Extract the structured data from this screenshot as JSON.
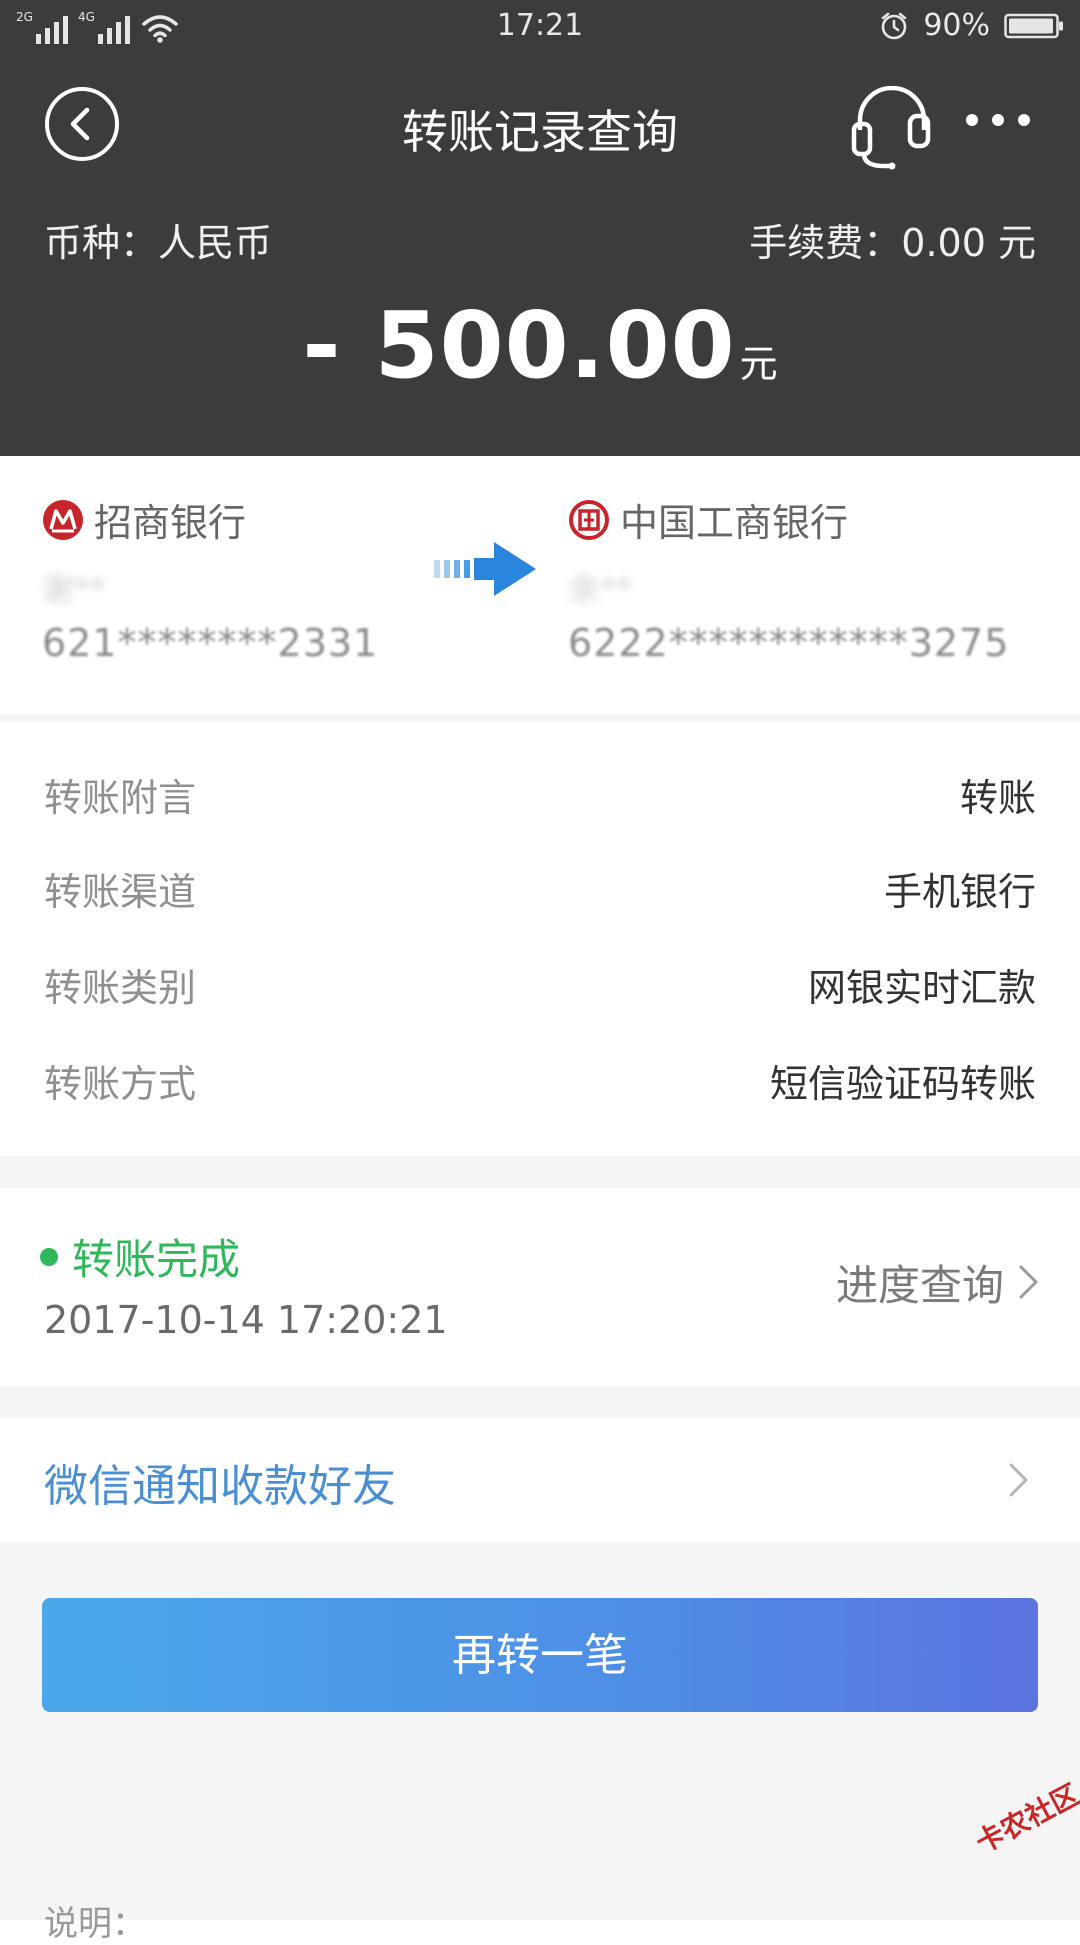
{
  "status_bar": {
    "network_1": "2G",
    "network_2": "4G",
    "time": "17:21",
    "battery": "90%"
  },
  "header": {
    "title": "转账记录查询",
    "currency_label": "币种：人民币",
    "fee_label": "手续费：0.00 元",
    "amount": "- 500.00",
    "amount_unit": "元"
  },
  "accounts": {
    "from": {
      "bank": "招商银行",
      "name": "谢**",
      "number": "621********2331"
    },
    "to": {
      "bank": "中国工商银行",
      "name": "余**",
      "number": "6222************3275"
    }
  },
  "details": [
    {
      "label": "转账附言",
      "value": "转账"
    },
    {
      "label": "转账渠道",
      "value": "手机银行"
    },
    {
      "label": "转账类别",
      "value": "网银实时汇款"
    },
    {
      "label": "转账方式",
      "value": "短信验证码转账"
    }
  ],
  "status": {
    "text": "转账完成",
    "time": "2017-10-14 17:20:21",
    "progress_link": "进度查询"
  },
  "wechat_notify": "微信通知收款好友",
  "again_button": "再转一笔",
  "note_label": "说明：",
  "watermark": "卡农社区",
  "colors": {
    "header_bg": "#3c3c3c",
    "success": "#2fb85a",
    "link": "#4a8fd4",
    "button_start": "#4aa8ea",
    "button_end": "#5b74de"
  },
  "icons": [
    "back-icon",
    "headset-icon",
    "more-icon",
    "cmb-logo-icon",
    "icbc-logo-icon",
    "transfer-arrow-icon",
    "chevron-right-icon",
    "wifi-icon",
    "alarm-icon",
    "battery-icon"
  ]
}
